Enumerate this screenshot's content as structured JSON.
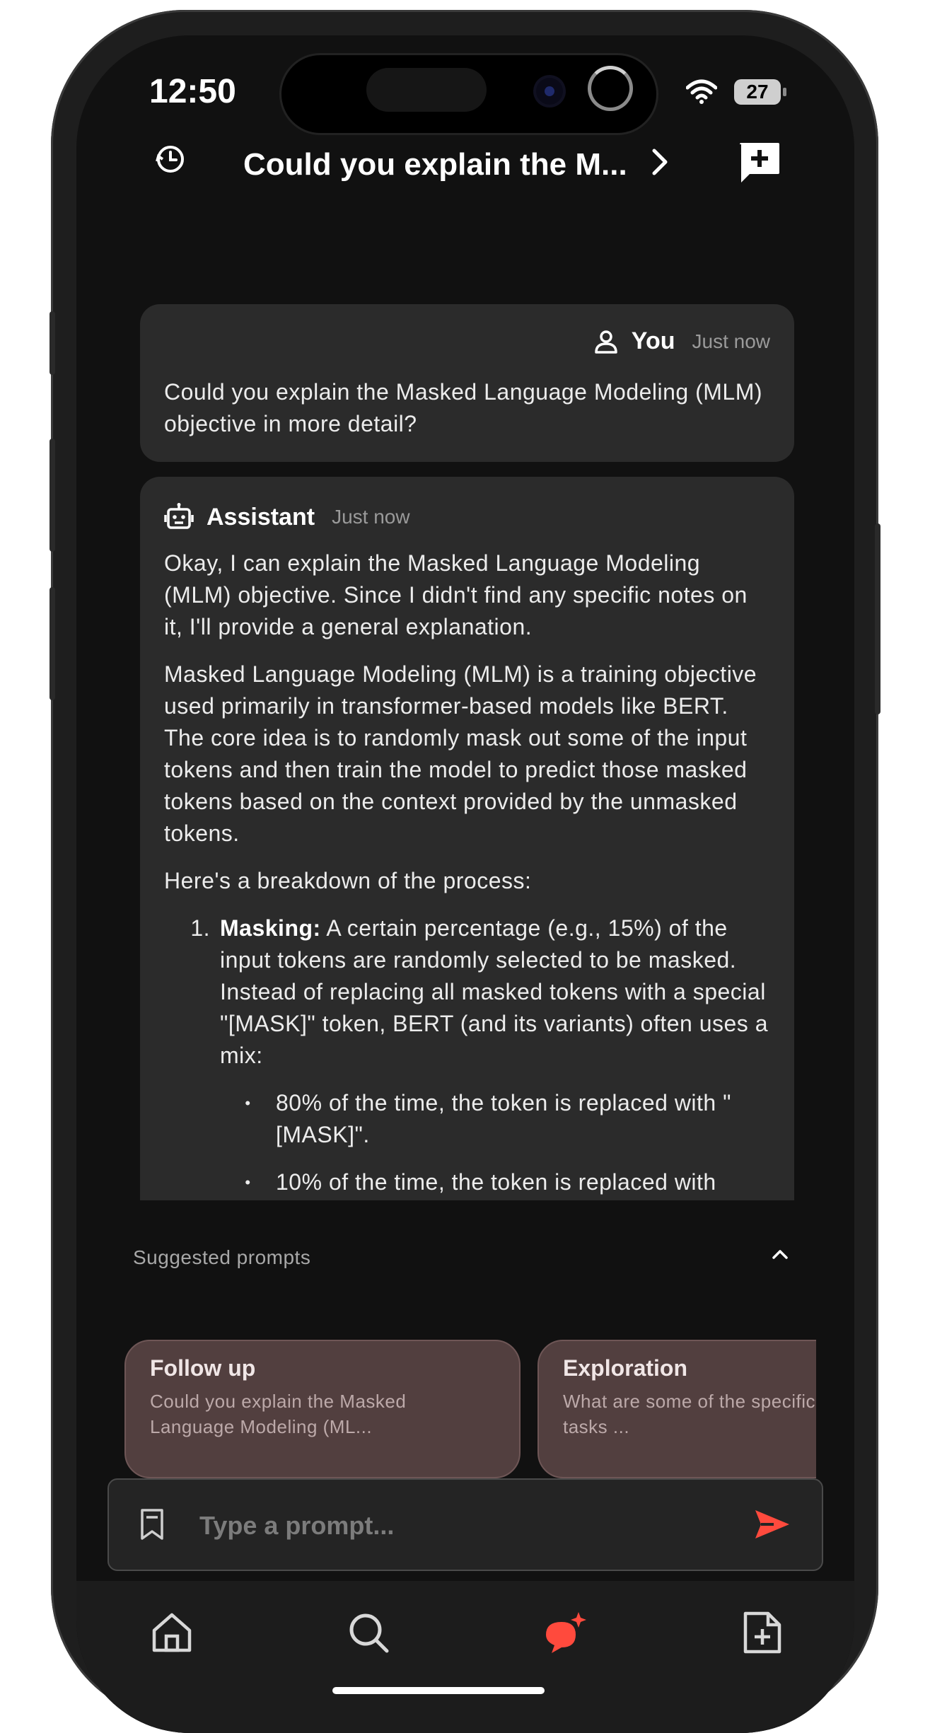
{
  "status": {
    "time": "12:50",
    "battery": "27"
  },
  "header": {
    "title": "Could you explain the M...",
    "history_icon": "history-clock-icon",
    "chevron_icon": "chevron-right-icon",
    "new_chat_icon": "new-chat-icon"
  },
  "messages": {
    "user": {
      "author": "You",
      "time": "Just now",
      "text": "Could you explain the Masked Language Modeling (MLM) objective in more detail?"
    },
    "assistant": {
      "author": "Assistant",
      "time": "Just now",
      "paragraphs": [
        "Okay, I can explain the Masked Language Modeling (MLM) objective. Since I didn't find any specific notes on it, I'll provide a general explanation.",
        "Masked Language Modeling (MLM) is a training objective used primarily in transformer-based models like BERT. The core idea is to randomly mask out some of the input tokens and then train the model to predict those masked tokens based on the context provided by the unmasked tokens.",
        "Here's a breakdown of the process:"
      ],
      "list": [
        {
          "number": "1.",
          "bold": "Masking:",
          "text": " A certain percentage (e.g., 15%) of the input tokens are randomly selected to be masked.  Instead of replacing all masked tokens with a special \"[MASK]\" token, BERT (and its variants) often uses a mix:",
          "bullets": [
            "80% of the time, the token is replaced with \"[MASK]\".",
            "10% of the time, the token is replaced with"
          ]
        }
      ]
    }
  },
  "suggestions": {
    "title": "Suggested prompts",
    "cards": [
      {
        "title": "Follow up",
        "text": "Could you explain the Masked Language Modeling (ML..."
      },
      {
        "title": "Exploration",
        "text": "What are some of the specific lingual tasks ..."
      }
    ]
  },
  "input": {
    "placeholder": "Type a prompt..."
  },
  "nav": {
    "items": [
      {
        "icon": "home-icon"
      },
      {
        "icon": "search-icon"
      },
      {
        "icon": "ai-chat-icon",
        "active": true
      },
      {
        "icon": "add-document-icon"
      }
    ]
  },
  "colors": {
    "accent": "#ff4a3d",
    "bubble": "#2b2b2b",
    "card": "#523f3f",
    "background": "#111111"
  }
}
